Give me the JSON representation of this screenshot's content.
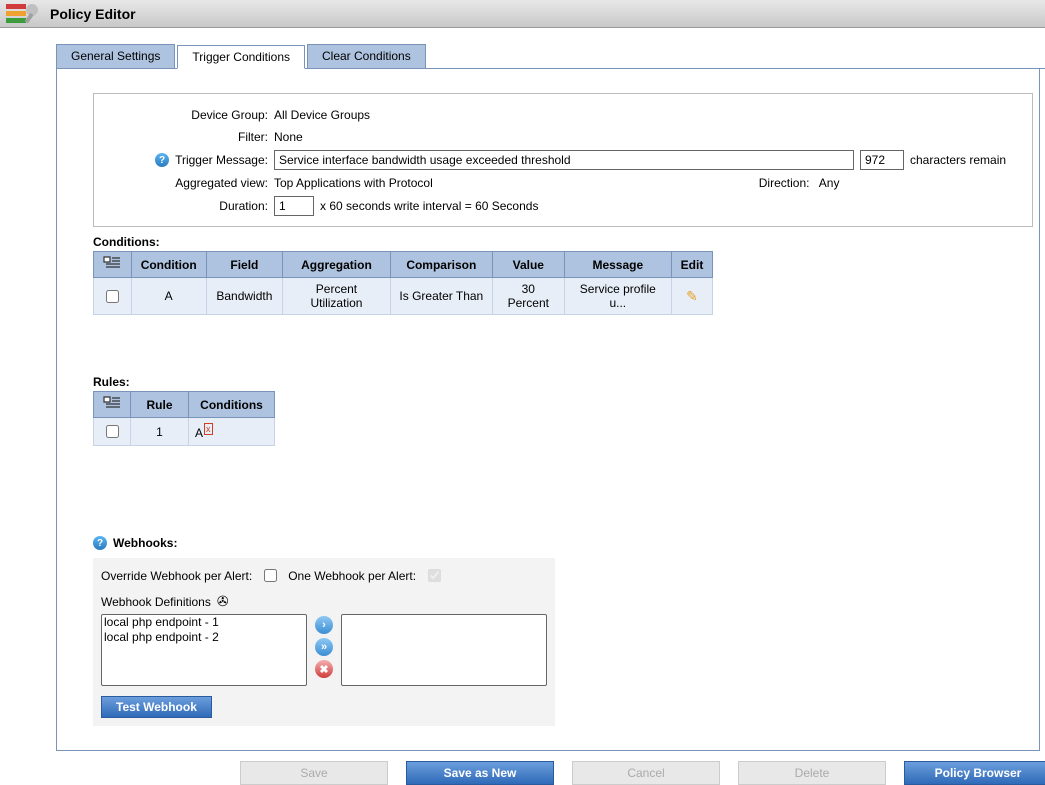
{
  "window": {
    "title": "Policy Editor"
  },
  "tabs": {
    "general": "General Settings",
    "trigger": "Trigger Conditions",
    "clear": "Clear Conditions",
    "active": "trigger"
  },
  "form": {
    "device_group_label": "Device Group:",
    "device_group_value": "All Device Groups",
    "filter_label": "Filter:",
    "filter_value": "None",
    "trigger_msg_label": "Trigger Message:",
    "trigger_msg_value": "Service interface bandwidth usage exceeded threshold",
    "chars_remaining_value": "972",
    "chars_remaining_label": "characters remain",
    "agg_view_label": "Aggregated view:",
    "agg_view_value": "Top Applications with Protocol",
    "direction_label": "Direction:",
    "direction_value": "Any",
    "duration_label": "Duration:",
    "duration_value": "1",
    "duration_suffix": "x 60 seconds write interval = 60 Seconds"
  },
  "conditions": {
    "section_label": "Conditions:",
    "columns": [
      "Condition",
      "Field",
      "Aggregation",
      "Comparison",
      "Value",
      "Message",
      "Edit"
    ],
    "rows": [
      {
        "condition": "A",
        "field": "Bandwidth",
        "aggregation": "Percent Utilization",
        "comparison": "Is Greater Than",
        "value": "30 Percent",
        "message": "Service profile u..."
      }
    ]
  },
  "rules": {
    "section_label": "Rules:",
    "columns": [
      "Rule",
      "Conditions"
    ],
    "rows": [
      {
        "rule": "1",
        "conditions": "A"
      }
    ]
  },
  "webhooks": {
    "header": "Webhooks:",
    "override_label": "Override Webhook per Alert:",
    "one_per_alert_label": "One Webhook per Alert:",
    "defs_label": "Webhook Definitions",
    "available": [
      "local php endpoint - 1",
      "local php endpoint - 2"
    ],
    "test_button": "Test Webhook"
  },
  "footer": {
    "save": "Save",
    "save_as_new": "Save as New",
    "cancel": "Cancel",
    "delete": "Delete",
    "policy_browser": "Policy Browser"
  }
}
